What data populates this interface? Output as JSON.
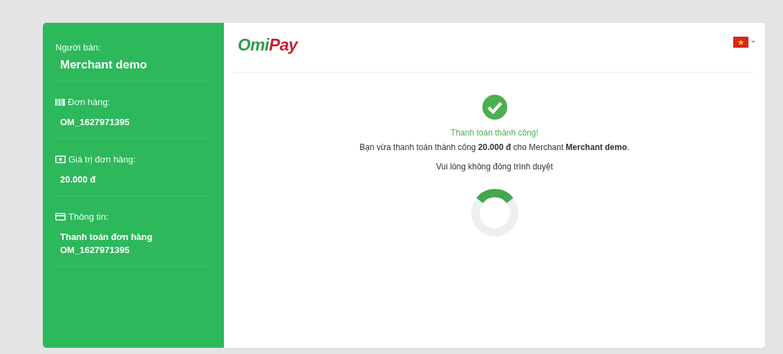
{
  "sidebar": {
    "items": [
      {
        "kind": "none",
        "label": "Người bán:",
        "value": "Merchant demo"
      },
      {
        "kind": "barcode",
        "label": "Đơn hàng:",
        "value": "OM_1627971395"
      },
      {
        "kind": "money",
        "label": "Giá trị đơn hàng:",
        "value": "20.000 đ"
      },
      {
        "kind": "card",
        "label": "Thông tin:",
        "value": "Thanh toán đơn hàng OM_1627971395"
      }
    ]
  },
  "header": {
    "logo": {
      "first": "Omi",
      "second": "Pay"
    }
  },
  "result": {
    "title": "Thanh toán thành công!",
    "message": "Bạn vừa thanh toán thành công **20.000 đ** cho Merchant **Merchant demo**.",
    "notice": "Vui lòng không đóng trình duyệt"
  }
}
